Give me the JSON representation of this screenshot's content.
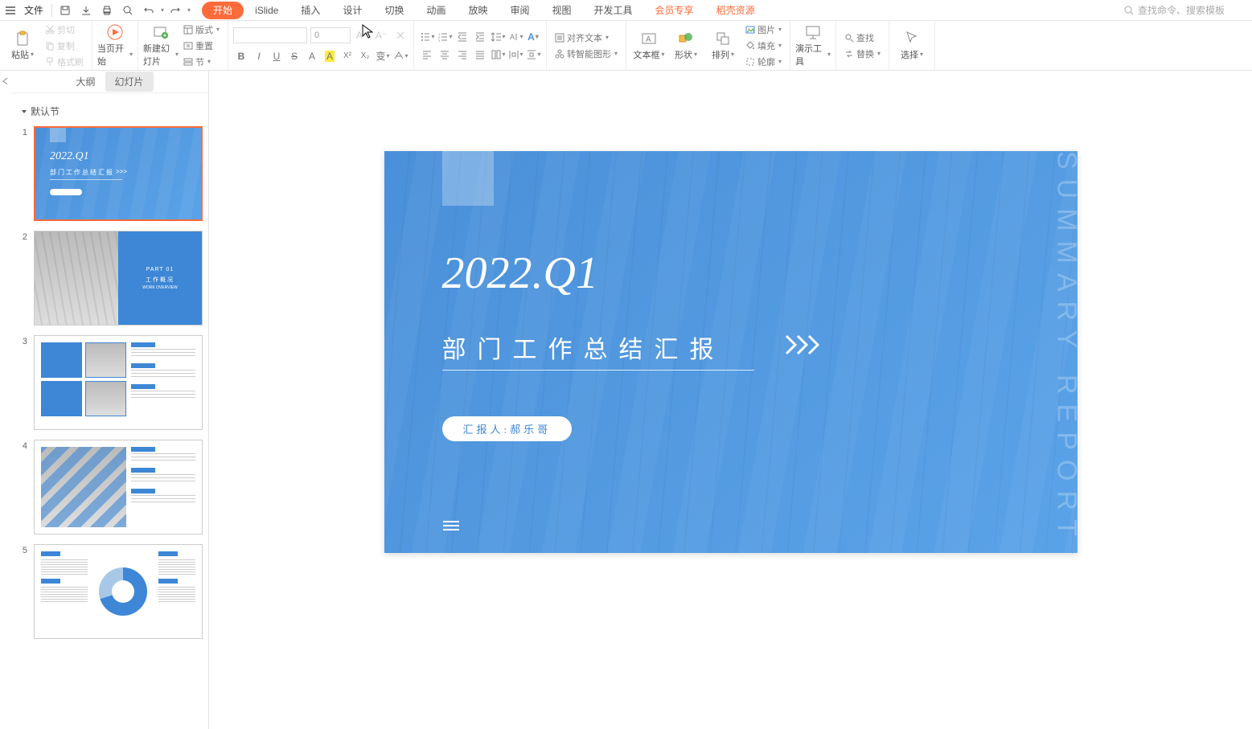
{
  "topbar": {
    "file": "文件",
    "search_placeholder": "查找命令、搜索模板"
  },
  "tabs": {
    "start": "开始",
    "islide": "iSlide",
    "insert": "插入",
    "design": "设计",
    "transition": "切换",
    "animation": "动画",
    "slideshow": "放映",
    "review": "审阅",
    "view": "视图",
    "devtools": "开发工具",
    "member": "会员专享",
    "docer": "稻壳资源"
  },
  "ribbon": {
    "paste": "粘贴",
    "cut": "剪切",
    "copy": "复制",
    "format_painter": "格式刷",
    "from_current": "当页开始",
    "new_slide": "新建幻灯片",
    "layout": "版式",
    "reset": "重置",
    "section": "节",
    "font_size": "0",
    "align_text": "对齐文本",
    "smartart": "转智能图形",
    "text_box": "文本框",
    "shape": "形状",
    "arrange": "排列",
    "picture": "图片",
    "fill": "填充",
    "outline": "轮廓",
    "present_tools": "演示工具",
    "find": "查找",
    "replace": "替换",
    "select": "选择"
  },
  "left_panel": {
    "outline_tab": "大纲",
    "slides_tab": "幻灯片",
    "section_name": "默认节"
  },
  "thumbs": {
    "t1_year": "2022.Q1",
    "t1_title": "部门工作总结汇报",
    "t1_arrow": ">>>",
    "t2_part": "PART 01",
    "t2_title": "工作概况",
    "t2_sub": "WORK OVERVIEW"
  },
  "slide": {
    "year": "2022.Q1",
    "title": "部门工作总结汇报",
    "reporter": "汇报人:郝乐哥",
    "side_text": "SUMMARY REPORT"
  },
  "slide_numbers": [
    "1",
    "2",
    "3",
    "4",
    "5"
  ]
}
